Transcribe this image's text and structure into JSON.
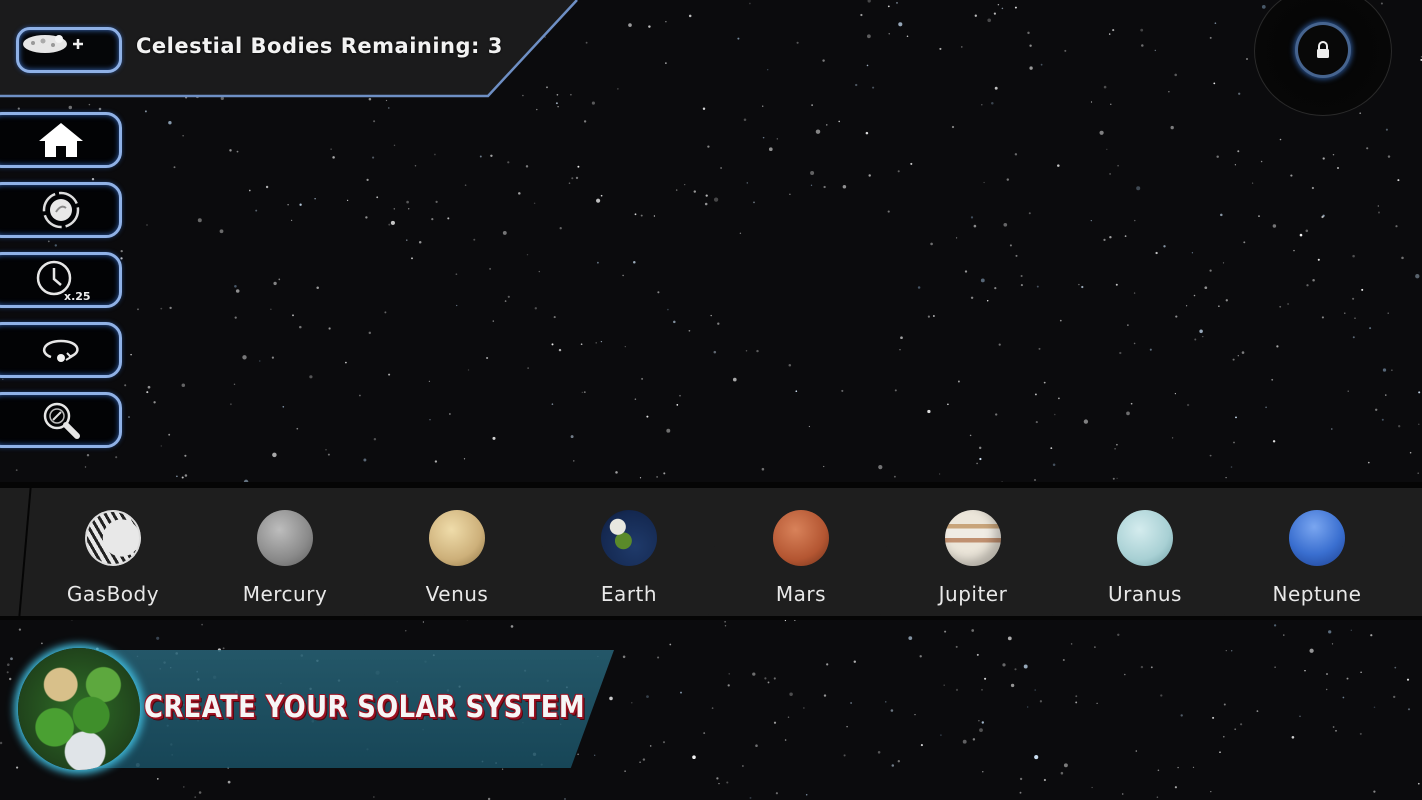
{
  "header": {
    "add_body_icon": "asteroid-plus-icon",
    "remaining_label": "Celestial Bodies Remaining: 3",
    "remaining_count": 3
  },
  "sidebar": {
    "buttons": [
      {
        "id": "home",
        "icon": "home-icon"
      },
      {
        "id": "orbit",
        "icon": "orbit-icon"
      },
      {
        "id": "time-speed",
        "icon": "clock-icon",
        "badge": "x.25"
      },
      {
        "id": "rotate-view",
        "icon": "rotate-icon"
      },
      {
        "id": "zoom",
        "icon": "magnifier-icon"
      }
    ]
  },
  "compass": {
    "icon": "lock-icon"
  },
  "carousel": {
    "items": [
      {
        "label": "GasBody",
        "color": "#d9d9d9",
        "type": "gas"
      },
      {
        "label": "Mercury",
        "color": "#9a9a9a"
      },
      {
        "label": "Venus",
        "color": "#d9c18c"
      },
      {
        "label": "Earth",
        "color": "#2a4a7a"
      },
      {
        "label": "Mars",
        "color": "#c0603a"
      },
      {
        "label": "Jupiter",
        "color": "#e0d0b8"
      },
      {
        "label": "Uranus",
        "color": "#b8dde0"
      },
      {
        "label": "Neptune",
        "color": "#3a6fd0"
      }
    ]
  },
  "banner": {
    "title": "CREATE YOUR SOLAR SYSTEM",
    "accent": "#9a1020"
  }
}
